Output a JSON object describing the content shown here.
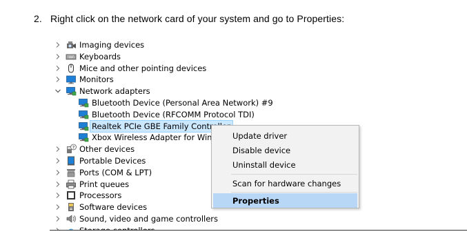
{
  "instruction": {
    "number": "2.",
    "text": "Right click on the network card of your system and go to Properties:"
  },
  "device_tree": [
    {
      "label": "Imaging devices",
      "icon": "camera-icon",
      "expander": "collapsed"
    },
    {
      "label": "Keyboards",
      "icon": "keyboard-icon",
      "expander": "collapsed"
    },
    {
      "label": "Mice and other pointing devices",
      "icon": "mouse-icon",
      "expander": "collapsed"
    },
    {
      "label": "Monitors",
      "icon": "monitor-icon",
      "expander": "collapsed"
    },
    {
      "label": "Network adapters",
      "icon": "network-adapter-icon",
      "expander": "expanded"
    },
    {
      "label": "Bluetooth Device (Personal Area Network) #9",
      "icon": "network-adapter-icon",
      "expander": "none"
    },
    {
      "label": "Bluetooth Device (RFCOMM Protocol TDI)",
      "icon": "network-adapter-icon",
      "expander": "none"
    },
    {
      "label": "Realtek PCIe GBE Family Controller",
      "icon": "network-adapter-icon",
      "expander": "none",
      "selected": true
    },
    {
      "label": "Xbox Wireless Adapter for Windows",
      "icon": "network-adapter-icon",
      "expander": "none"
    },
    {
      "label": "Other devices",
      "icon": "unknown-device-icon",
      "expander": "collapsed"
    },
    {
      "label": "Portable Devices",
      "icon": "portable-device-icon",
      "expander": "collapsed"
    },
    {
      "label": "Ports (COM & LPT)",
      "icon": "port-icon",
      "expander": "collapsed"
    },
    {
      "label": "Print queues",
      "icon": "printer-icon",
      "expander": "collapsed"
    },
    {
      "label": "Processors",
      "icon": "processor-icon",
      "expander": "collapsed"
    },
    {
      "label": "Software devices",
      "icon": "software-device-icon",
      "expander": "collapsed"
    },
    {
      "label": "Sound, video and game controllers",
      "icon": "speaker-icon",
      "expander": "collapsed"
    },
    {
      "label": "Storage controllers",
      "icon": "storage-controller-icon",
      "expander": "collapsed"
    }
  ],
  "context_menu": {
    "items": [
      {
        "label": "Update driver"
      },
      {
        "label": "Disable device"
      },
      {
        "label": "Uninstall device"
      },
      {
        "label": "Scan for hardware changes"
      },
      {
        "label": "Properties",
        "highlighted": true
      }
    ]
  },
  "colors": {
    "selection_bg": "#cce8ff",
    "menu_bg": "#f2f2f2",
    "menu_highlight": "#b8d6f5",
    "icon_blue": "#1e7fd6"
  }
}
